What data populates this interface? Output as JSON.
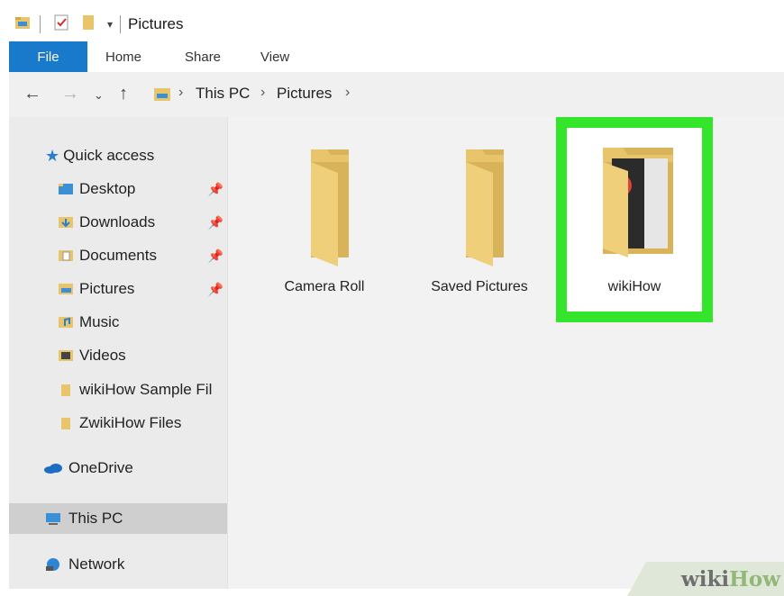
{
  "window": {
    "title": "Pictures"
  },
  "ribbon": {
    "tabs": [
      "File",
      "Home",
      "Share",
      "View"
    ]
  },
  "address": {
    "crumbs": [
      "This PC",
      "Pictures"
    ]
  },
  "sidebar": {
    "quick_access": "Quick access",
    "items": [
      {
        "label": "Desktop",
        "pinned": true,
        "icon": "desktop-icon"
      },
      {
        "label": "Downloads",
        "pinned": true,
        "icon": "downloads-icon"
      },
      {
        "label": "Documents",
        "pinned": true,
        "icon": "documents-icon"
      },
      {
        "label": "Pictures",
        "pinned": true,
        "icon": "pictures-icon"
      },
      {
        "label": "Music",
        "pinned": false,
        "icon": "music-icon"
      },
      {
        "label": "Videos",
        "pinned": false,
        "icon": "videos-icon"
      },
      {
        "label": "wikiHow Sample Fil",
        "pinned": false,
        "icon": "folder-icon"
      },
      {
        "label": "ZwikiHow Files",
        "pinned": false,
        "icon": "folder-icon"
      }
    ],
    "onedrive": "OneDrive",
    "this_pc": "This PC",
    "network": "Network"
  },
  "folders": [
    {
      "label": "Camera Roll"
    },
    {
      "label": "Saved Pictures"
    },
    {
      "label": "wikiHow",
      "selected": true
    }
  ],
  "colors": {
    "accent": "#1979ca",
    "highlight": "#35e52b",
    "folder": "#e8c46a"
  },
  "watermark": {
    "part1": "wiki",
    "part2": "How"
  }
}
